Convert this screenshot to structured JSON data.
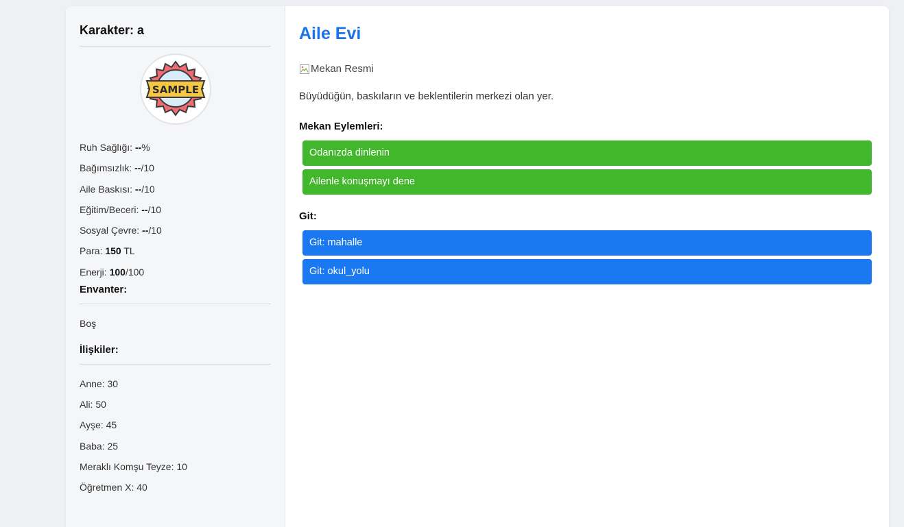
{
  "character": {
    "title": "Karakter: a",
    "avatar_alt": "SAMPLE",
    "stats": [
      {
        "label": "Ruh Sağlığı: ",
        "value": "--",
        "suffix": "%"
      },
      {
        "label": "Bağımsızlık: ",
        "value": "--",
        "suffix": "/10"
      },
      {
        "label": "Aile Baskısı: ",
        "value": "--",
        "suffix": "/10"
      },
      {
        "label": "Eğitim/Beceri: ",
        "value": "--",
        "suffix": "/10"
      },
      {
        "label": "Sosyal Çevre: ",
        "value": "--",
        "suffix": "/10"
      },
      {
        "label": "Para: ",
        "value": "150",
        "suffix": " TL"
      },
      {
        "label": "Enerji: ",
        "value": "100",
        "suffix": "/100"
      }
    ],
    "inventory": {
      "title": "Envanter:",
      "empty_text": "Boş"
    },
    "relations": {
      "title": "İlişkiler:",
      "items": [
        "Anne: 30",
        "Ali: 50",
        "Ayşe: 45",
        "Baba: 25",
        "Meraklı Komşu Teyze: 10",
        "Öğretmen X: 40"
      ]
    }
  },
  "location": {
    "name": "Aile Evi",
    "image_alt": "Mekan Resmi",
    "description": "Büyüdüğün, baskıların ve beklentilerin merkezi olan yer.",
    "actions_title": "Mekan Eylemleri:",
    "actions": [
      "Odanızda dinlenin",
      "Ailenle konuşmayı dene"
    ],
    "go_title": "Git:",
    "go_targets": [
      "Git: mahalle",
      "Git: okul_yolu"
    ]
  },
  "colors": {
    "accent_blue": "#1a73e8",
    "action_green": "#43b72c",
    "go_blue": "#1a78f0"
  }
}
